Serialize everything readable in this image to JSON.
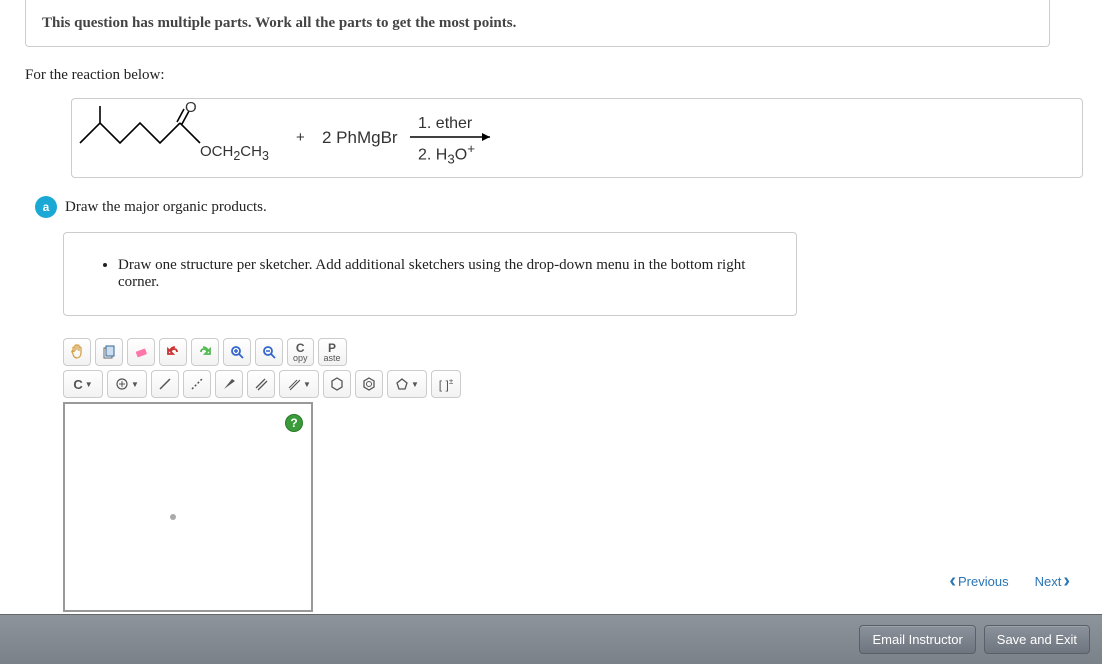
{
  "banner": "This question has multiple parts. Work all the parts to get the most points.",
  "intro": "For the reaction below:",
  "reaction": {
    "reagent_plus": "+",
    "reagent_text": "2 PhMgBr",
    "step1": "1. ether",
    "step2_prefix": "2. H",
    "step2_sub": "3",
    "step2_o": "O",
    "step2_sup": "+",
    "sub_label_prefix": "OCH",
    "sub_label_sub": "2",
    "sub_label_mid": "CH",
    "sub_label_sub2": "3",
    "o_label": "O"
  },
  "part": {
    "letter": "a",
    "text": "Draw the major organic products."
  },
  "hint": "Draw one structure per sketcher. Add additional sketchers using the drop-down menu in the bottom right corner.",
  "toolbar": {
    "copy_big": "C",
    "copy_sm": "opy",
    "paste_big": "P",
    "paste_sm": "aste",
    "elem": "C",
    "bracket": "[ ]",
    "charge_sup": "±"
  },
  "help": "?",
  "nav": {
    "previous": "Previous",
    "next": "Next"
  },
  "footer": {
    "email": "Email Instructor",
    "save": "Save and Exit"
  }
}
